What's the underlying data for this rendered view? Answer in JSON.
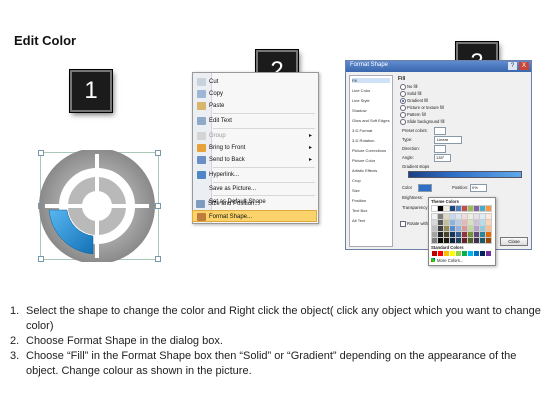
{
  "page": {
    "title": "Edit Color"
  },
  "steps": {
    "badge1": "1",
    "badge2": "2",
    "badge3": "3"
  },
  "context_menu": {
    "items": [
      {
        "label": "Cut",
        "icon": "scissors-icon",
        "disabled": false,
        "submenu": false
      },
      {
        "label": "Copy",
        "icon": "copy-icon",
        "disabled": false,
        "submenu": false
      },
      {
        "label": "Paste",
        "icon": "paste-icon",
        "disabled": false,
        "submenu": false
      },
      {
        "label": "Edit Text",
        "icon": "edit-text-icon",
        "disabled": false,
        "submenu": false
      },
      {
        "label": "Group",
        "icon": "group-icon",
        "disabled": true,
        "submenu": true
      },
      {
        "label": "Bring to Front",
        "icon": "bring-front-icon",
        "disabled": false,
        "submenu": true
      },
      {
        "label": "Send to Back",
        "icon": "send-back-icon",
        "disabled": false,
        "submenu": true
      },
      {
        "label": "Hyperlink...",
        "icon": "hyperlink-icon",
        "disabled": false,
        "submenu": false
      },
      {
        "label": "Save as Picture...",
        "icon": "",
        "disabled": false,
        "submenu": false
      },
      {
        "label": "Set as Default Shape",
        "icon": "",
        "disabled": false,
        "submenu": false
      },
      {
        "label": "Size and Position...",
        "icon": "size-position-icon",
        "disabled": false,
        "submenu": false
      },
      {
        "label": "Format Shape...",
        "icon": "format-shape-icon",
        "disabled": false,
        "submenu": false,
        "highlighted": true
      }
    ]
  },
  "dialog": {
    "title": "Format Shape",
    "help": "?",
    "close": "X",
    "categories": [
      "Fill",
      "Line Color",
      "Line Style",
      "Shadow",
      "Glow and Soft Edges",
      "3-D Format",
      "3-D Rotation",
      "Picture Corrections",
      "Picture Color",
      "Artistic Effects",
      "Crop",
      "Size",
      "Position",
      "Text Box",
      "Alt Text"
    ],
    "section_title": "Fill",
    "fill_options": [
      {
        "label": "No fill",
        "selected": false
      },
      {
        "label": "Solid fill",
        "selected": false
      },
      {
        "label": "Gradient fill",
        "selected": true
      },
      {
        "label": "Picture or texture fill",
        "selected": false
      },
      {
        "label": "Pattern fill",
        "selected": false
      },
      {
        "label": "Slide background fill",
        "selected": false
      }
    ],
    "preset_colors_label": "Preset colors:",
    "type_label": "Type:",
    "type_value": "Linear",
    "direction_label": "Direction:",
    "angle_label": "Angle:",
    "angle_value": "135°",
    "gradient_stops_label": "Gradient stops",
    "color_label": "Color",
    "position_label": "Position:",
    "position_value": "0%",
    "brightness_label": "Brightness:",
    "transparency_label": "Transparency:",
    "rotate_label": "Rotate with shape",
    "close_button": "Close",
    "palette": {
      "theme_colors_label": "Theme Colors",
      "standard_colors_label": "Standard Colors",
      "more_colors_label": "More Colors...",
      "theme_rows": [
        [
          "#ffffff",
          "#000000",
          "#eeece1",
          "#1f497d",
          "#4f81bd",
          "#c0504d",
          "#9bbb59",
          "#8064a2",
          "#4bacc6",
          "#f79646"
        ],
        [
          "#f2f2f2",
          "#7f7f7f",
          "#ddd9c3",
          "#c6d9f0",
          "#dbe5f1",
          "#f2dcdb",
          "#ebf1dd",
          "#e5e0ec",
          "#dbeef3",
          "#fdeada"
        ],
        [
          "#d8d8d8",
          "#595959",
          "#c4bd97",
          "#8db3e2",
          "#b8cce4",
          "#e5b9b7",
          "#d7e3bc",
          "#ccc1d9",
          "#b7dde8",
          "#fbd5b5"
        ],
        [
          "#bfbfbf",
          "#3f3f3f",
          "#938953",
          "#548dd4",
          "#95b3d7",
          "#d99694",
          "#c3d69b",
          "#b2a2c7",
          "#92cddc",
          "#fac08f"
        ],
        [
          "#a5a5a5",
          "#262626",
          "#494429",
          "#17365d",
          "#366092",
          "#953734",
          "#76923c",
          "#5f497a",
          "#31859b",
          "#e36c09"
        ],
        [
          "#7f7f7f",
          "#0c0c0c",
          "#1d1b10",
          "#0f243e",
          "#244061",
          "#632423",
          "#4f6128",
          "#3f3151",
          "#205867",
          "#974806"
        ]
      ],
      "standard_row": [
        "#c00000",
        "#ff0000",
        "#ffc000",
        "#ffff00",
        "#92d050",
        "#00b050",
        "#00b0f0",
        "#0070c0",
        "#002060",
        "#7030a0"
      ]
    }
  },
  "instructions": [
    {
      "num": "1.",
      "text": "Select the shape to change the color and Right click the object( click any object which you want to change color)"
    },
    {
      "num": "2.",
      "text": "Choose Format Shape in the dialog box."
    },
    {
      "num": "3.",
      "text": "Choose “Fill” in the Format Shape box then “Solid” or “Gradient” depending on the appearance of the object. Change colour as shown in the picture."
    }
  ],
  "colors": {
    "accent_blue": "#1e8fd6",
    "wheel_gray": "#a8a8a8",
    "highlight": "#fbd36a"
  }
}
